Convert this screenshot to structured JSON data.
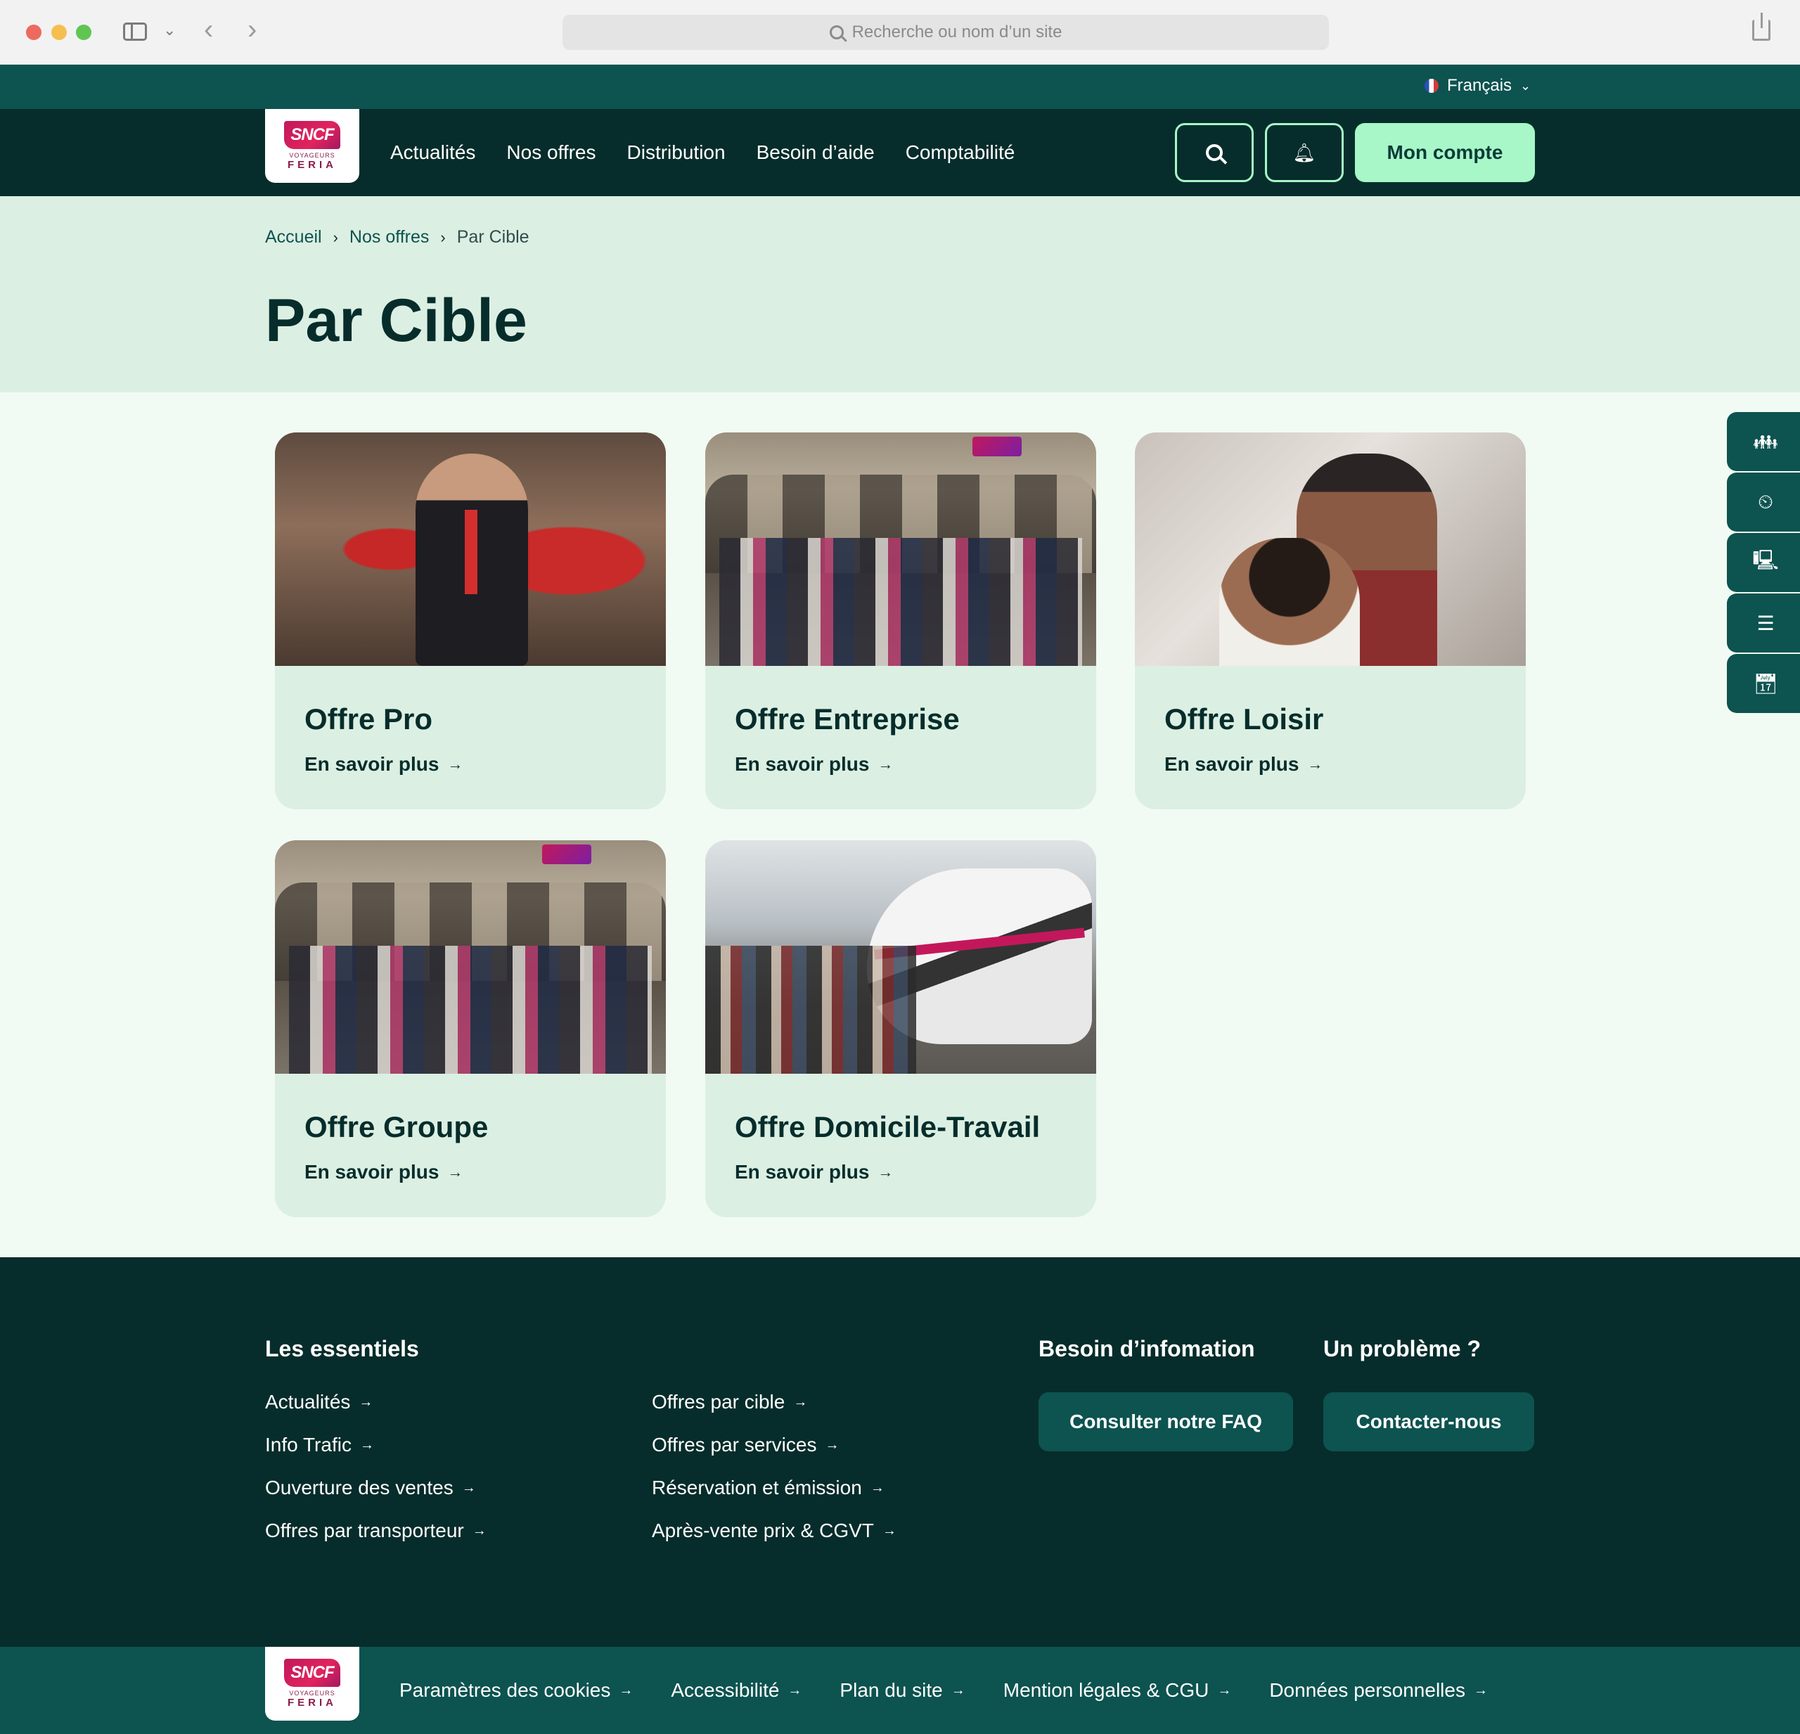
{
  "browser": {
    "url_placeholder": "Recherche ou nom d’un site"
  },
  "lang": {
    "label": "Français"
  },
  "logo": {
    "brand": "SNCF",
    "line1": "VOYAGEURS",
    "line2": "FERIA"
  },
  "nav": {
    "items": [
      "Actualités",
      "Nos offres",
      "Distribution",
      "Besoin d’aide",
      "Comptabilité"
    ],
    "account_label": "Mon compte"
  },
  "breadcrumb": {
    "home": "Accueil",
    "parent": "Nos offres",
    "current": "Par Cible",
    "separator": "›"
  },
  "page": {
    "title": "Par Cible"
  },
  "cards": [
    {
      "title": "Offre Pro",
      "link": "En savoir plus"
    },
    {
      "title": "Offre Entreprise",
      "link": "En savoir plus"
    },
    {
      "title": "Offre Loisir",
      "link": "En savoir plus"
    },
    {
      "title": "Offre Groupe",
      "link": "En savoir plus"
    },
    {
      "title": "Offre Domicile-Travail",
      "link": "En savoir plus"
    }
  ],
  "footer": {
    "essentials_title": "Les essentiels",
    "col1": [
      "Actualités",
      "Info Trafic",
      "Ouverture des ventes",
      "Offres par transporteur"
    ],
    "col2": [
      "Offres par cible",
      "Offres par services",
      "Réservation et émission",
      "Après-vente prix & CGVT"
    ],
    "info_title": "Besoin d’infomation",
    "info_button": "Consulter notre FAQ",
    "problem_title": "Un problème ?",
    "problem_button": "Contacter-nous"
  },
  "bottom": {
    "links": [
      "Paramètres des cookies",
      "Accessibilité",
      "Plan du site",
      "Mention légales & CGU",
      "Données personnelles"
    ]
  },
  "arrow": "→",
  "colors": {
    "header_bg": "#062d2b",
    "lang_bar_bg": "#0d5350",
    "accent": "#a8f7c8",
    "hero_bg": "#dcefe3",
    "page_bg": "#f1fbf3"
  }
}
